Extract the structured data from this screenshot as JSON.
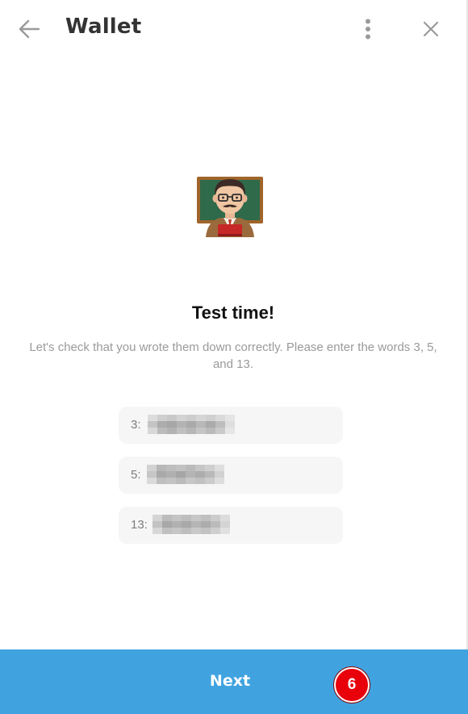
{
  "header": {
    "title": "Wallet",
    "back_icon": "arrow-left-icon",
    "menu_icon": "more-vertical-icon",
    "close_icon": "close-icon"
  },
  "illustration": {
    "icon": "teacher-emoji"
  },
  "content": {
    "heading": "Test time!",
    "description": "Let's check that you wrote them down correctly. Please enter the words 3, 5, and 13."
  },
  "fields": [
    {
      "label": "3:",
      "value_hidden": true
    },
    {
      "label": "5:",
      "value_hidden": true
    },
    {
      "label": "13:",
      "value_hidden": true
    }
  ],
  "footer": {
    "next_label": "Next",
    "step_badge": "6"
  },
  "colors": {
    "accent": "#40a3e0",
    "badge": "#e8000b",
    "field_bg": "#f6f6f6",
    "muted_text": "#9a9a9a"
  }
}
